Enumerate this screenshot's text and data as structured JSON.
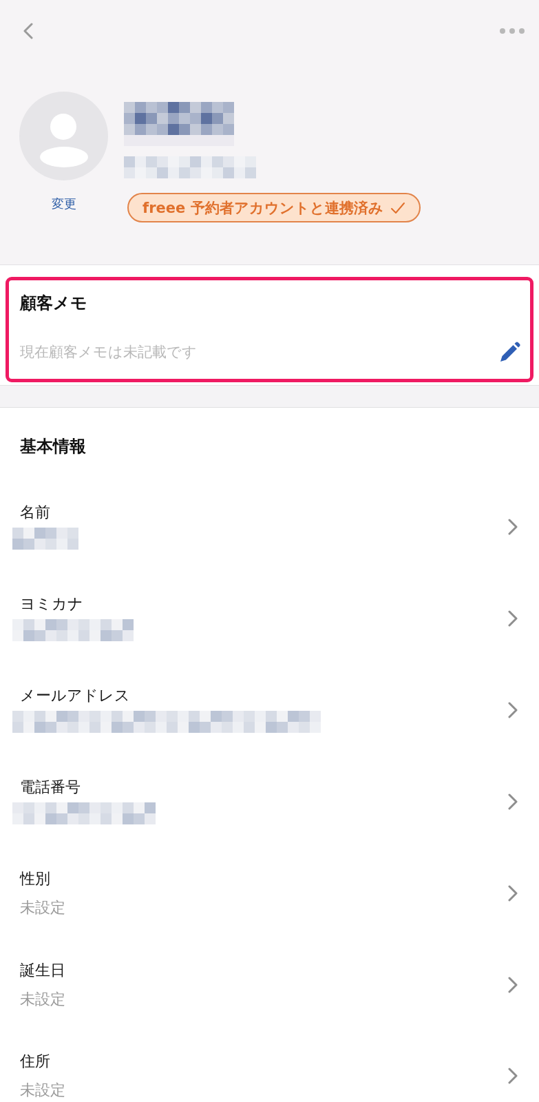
{
  "profile": {
    "avatar_action": "変更",
    "name_redacted": true,
    "subtitle_redacted": true,
    "badge": {
      "text": "freee 予約者アカウントと連携済み",
      "linked": true
    }
  },
  "memo": {
    "title": "顧客メモ",
    "placeholder": "現在顧客メモは未記載です",
    "highlighted": true
  },
  "basic_info": {
    "title": "基本情報",
    "rows": [
      {
        "label": "名前",
        "kind": "redacted"
      },
      {
        "label": "ヨミカナ",
        "kind": "redacted"
      },
      {
        "label": "メールアドレス",
        "kind": "redacted"
      },
      {
        "label": "電話番号",
        "kind": "redacted"
      },
      {
        "label": "性別",
        "kind": "text",
        "value": "未設定"
      },
      {
        "label": "誕生日",
        "kind": "text",
        "value": "未設定"
      },
      {
        "label": "住所",
        "kind": "text",
        "value": "未設定"
      }
    ]
  }
}
